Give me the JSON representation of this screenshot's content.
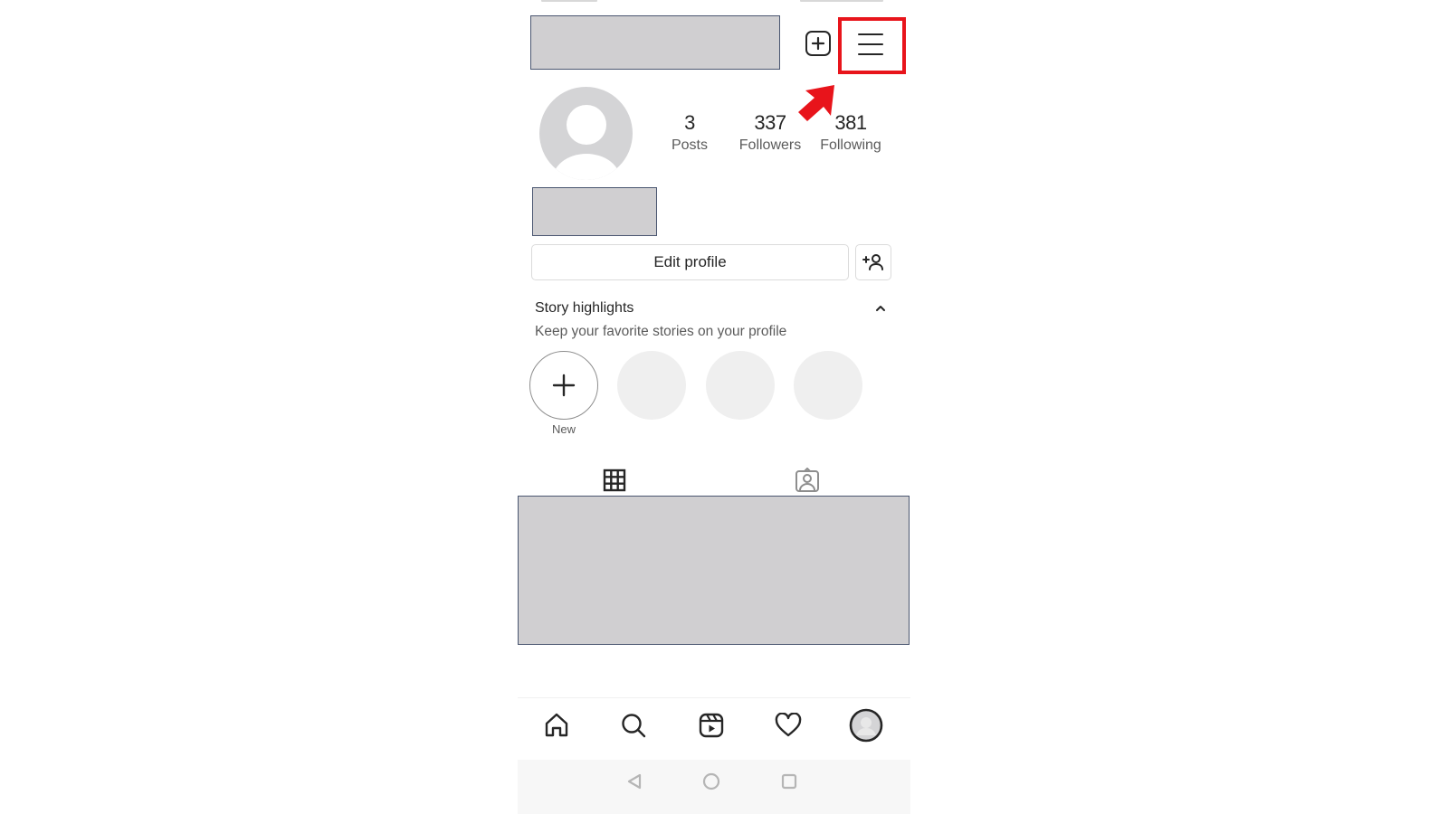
{
  "header": {
    "username_redacted": true,
    "add_post_icon": "plus-square-icon",
    "menu_icon": "hamburger-menu-icon",
    "annotation": {
      "highlight_color": "#e8141b",
      "arrow_color": "#e8141b"
    }
  },
  "profile": {
    "avatar_icon": "default-avatar-icon",
    "stats": [
      {
        "value": "3",
        "label": "Posts"
      },
      {
        "value": "337",
        "label": "Followers"
      },
      {
        "value": "381",
        "label": "Following"
      }
    ],
    "name_redacted": true,
    "edit_profile_label": "Edit profile",
    "discover_people_icon": "add-person-icon"
  },
  "story_highlights": {
    "title": "Story highlights",
    "subtitle": "Keep your favorite stories on your profile",
    "collapse_icon": "chevron-up-icon",
    "new_label": "New",
    "placeholder_count": 3
  },
  "tabs": [
    {
      "icon": "grid-icon",
      "active": true
    },
    {
      "icon": "tagged-icon",
      "active": false
    }
  ],
  "posts_grid_redacted": true,
  "bottom_nav": [
    {
      "icon": "home-icon"
    },
    {
      "icon": "search-icon"
    },
    {
      "icon": "reels-icon"
    },
    {
      "icon": "heart-icon"
    },
    {
      "icon": "profile-avatar-icon"
    }
  ],
  "system_nav": [
    {
      "icon": "back-icon"
    },
    {
      "icon": "home-circle-icon"
    },
    {
      "icon": "recents-icon"
    }
  ]
}
